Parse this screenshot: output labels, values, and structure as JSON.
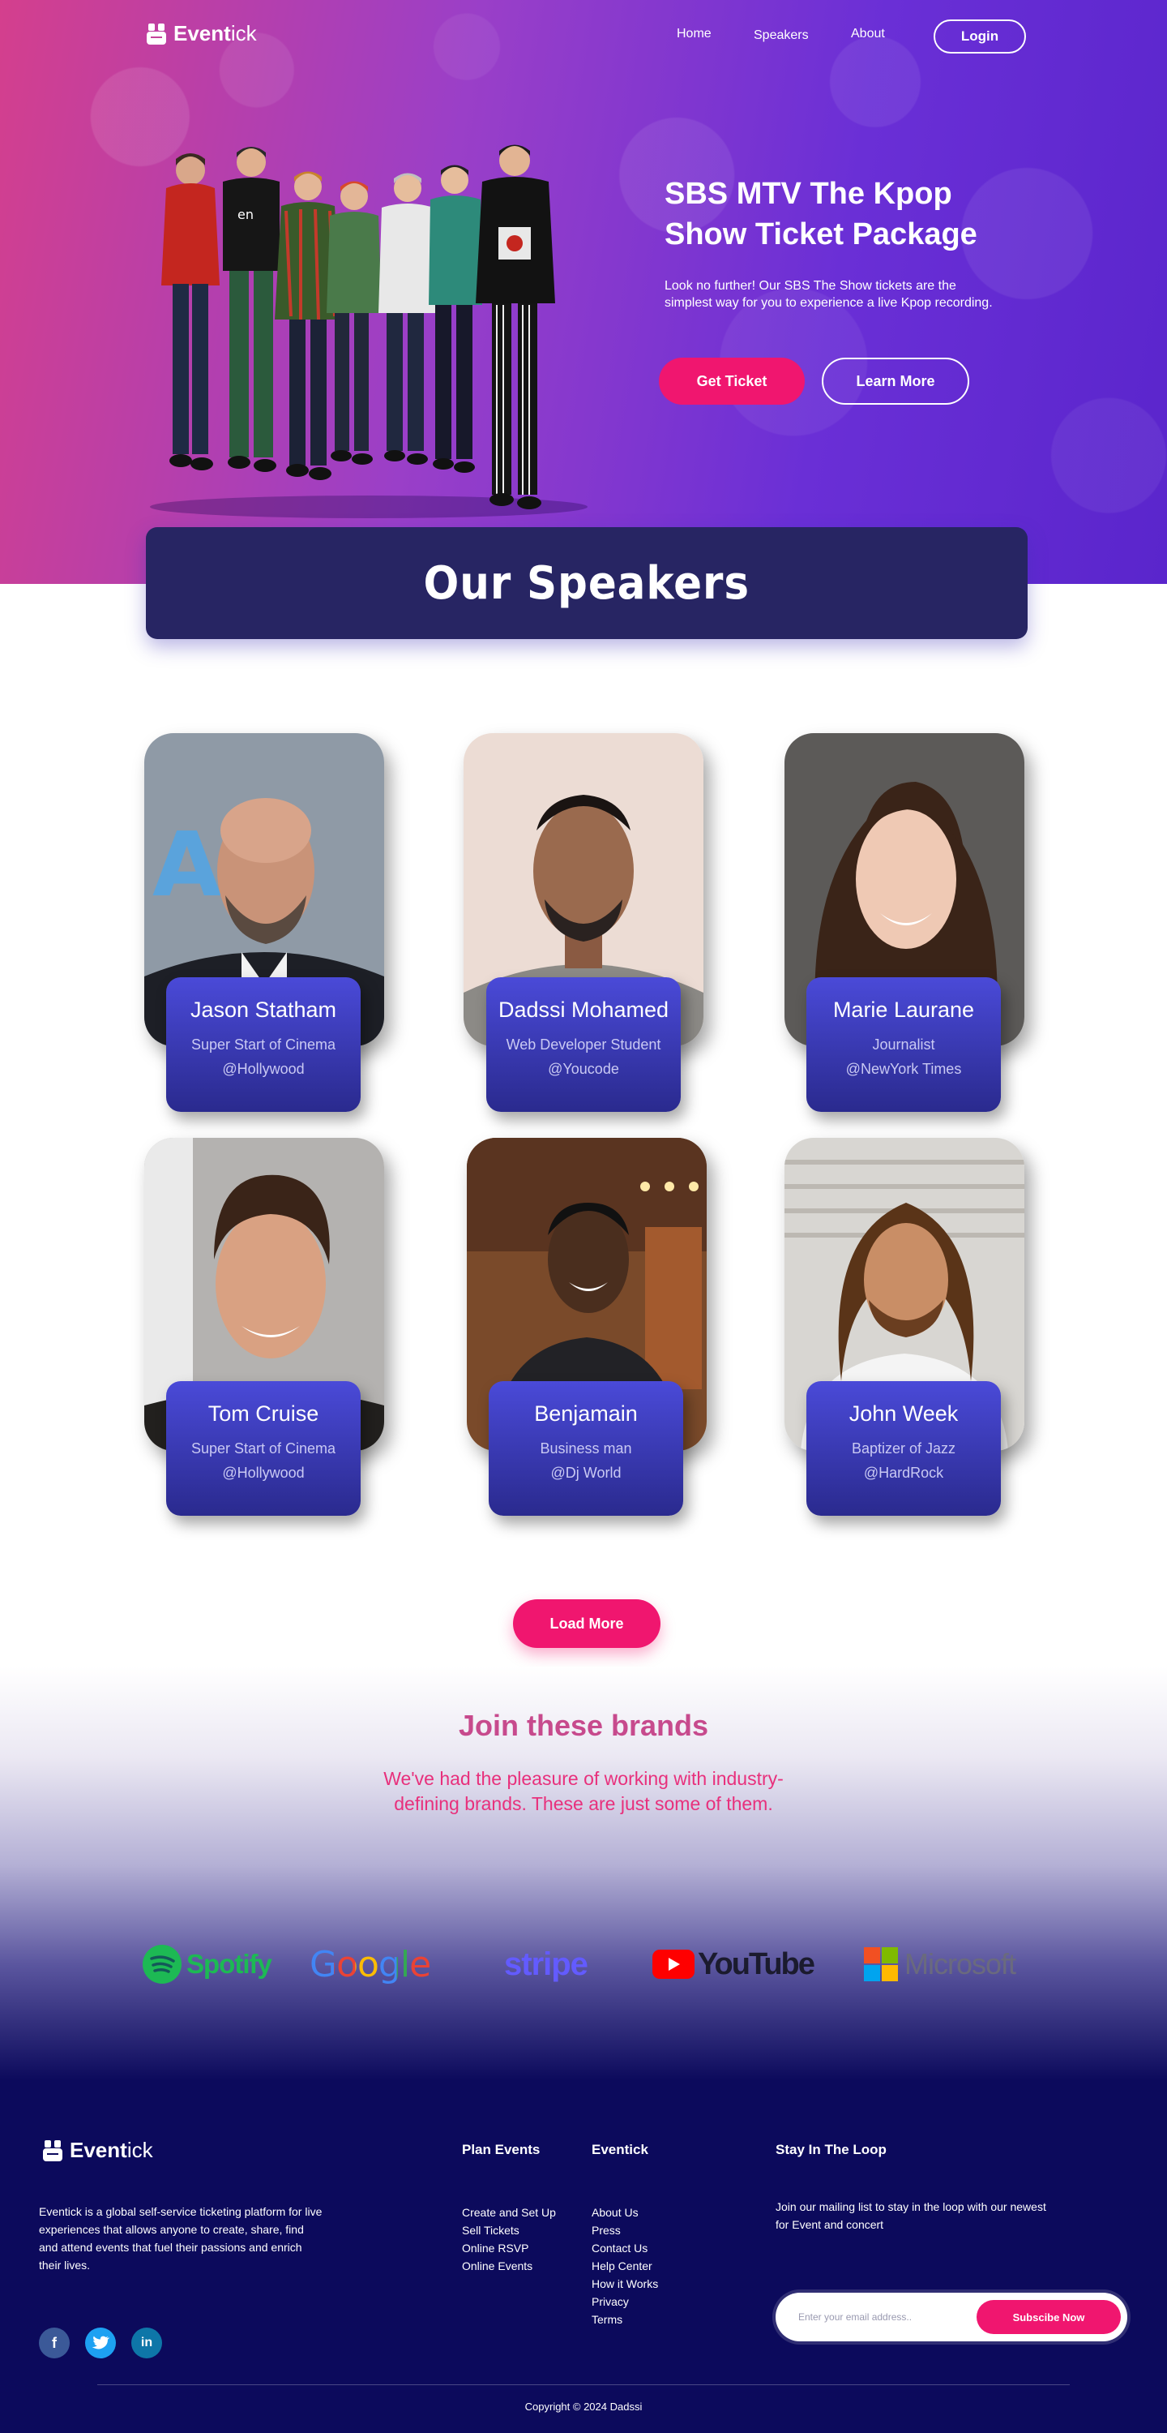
{
  "nav": {
    "logo_bold": "Event",
    "logo_thin": "ick",
    "home": "Home",
    "speakers": "Speakers",
    "about": "About",
    "login": "Login"
  },
  "hero": {
    "title": "SBS MTV The Kpop Show Ticket  Package",
    "description": "Look no further! Our SBS The Show tickets are the simplest way for you to experience a live Kpop recording.",
    "get_ticket": "Get Ticket",
    "learn_more": "Learn More"
  },
  "speakers_section": {
    "title": "Our Speakers",
    "cards": [
      {
        "name": "Jason Statham",
        "role": "Super Start of Cinema",
        "handle": "@Hollywood"
      },
      {
        "name": "Dadssi Mohamed",
        "role": "Web Developer Student",
        "handle": "@Youcode"
      },
      {
        "name": "Marie Laurane",
        "role": "Journalist",
        "handle": "@NewYork Times"
      },
      {
        "name": "Tom Cruise",
        "role": "Super Start of Cinema",
        "handle": "@Hollywood"
      },
      {
        "name": "Benjamain",
        "role": "Business man",
        "handle": "@Dj World"
      },
      {
        "name": "John Week",
        "role": "Baptizer of Jazz",
        "handle": "@HardRock"
      }
    ],
    "load_more": "Load More"
  },
  "brands_section": {
    "title": "Join these brands",
    "subtitle": "We've had the pleasure of working with industry-defining brands. These are just some of them.",
    "logos": [
      "Spotify",
      "Google",
      "stripe",
      "YouTube",
      "Microsoft"
    ]
  },
  "footer": {
    "logo_bold": "Event",
    "logo_thin": "ick",
    "description": "Eventick is a global self-service ticketing platform for live experiences that allows anyone to create, share, find and attend events that fuel their passions and enrich their lives.",
    "plan_events": {
      "title": "Plan Events",
      "items": [
        "Create and Set Up",
        "Sell Tickets",
        "Online RSVP",
        "Online Events"
      ]
    },
    "eventick": {
      "title": "Eventick",
      "items": [
        "About Us",
        "Press",
        "Contact Us",
        "Help Center",
        "How it Works",
        "Privacy",
        "Terms"
      ]
    },
    "stay_in_loop": {
      "title": "Stay In The Loop",
      "text": "Join our mailing list to stay in the loop with our newest for Event and concert",
      "email_placeholder": "Enter your email address..",
      "subscribe": "Subscibe Now"
    },
    "social": {
      "facebook": "f",
      "twitter": "t",
      "linkedin": "in"
    },
    "copyright": "Copyright © 2024 Dadssi"
  },
  "colors": {
    "accent": "#f0166f",
    "navy": "#272563",
    "footer_bg": "#0c0a5c",
    "card_gradient_top": "#4a4ad8",
    "card_gradient_bottom": "#2a2a8e"
  }
}
